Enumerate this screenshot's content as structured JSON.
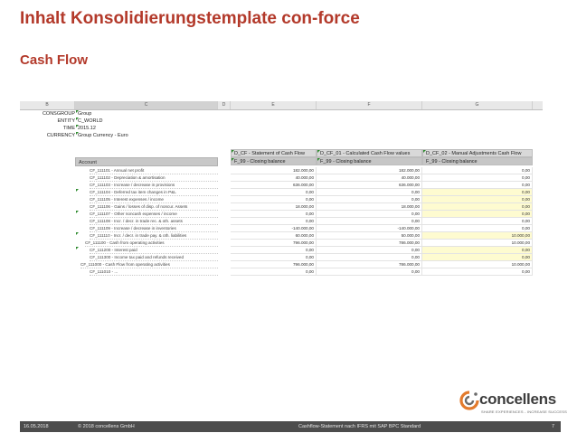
{
  "slide": {
    "title": "Inhalt Konsolidierungstemplate con-force",
    "subtitle": "Cash Flow"
  },
  "sheet": {
    "columns": [
      "B",
      "C",
      "D",
      "E",
      "F",
      "G"
    ],
    "meta": [
      {
        "key": "CONSGROUP",
        "value": "Group"
      },
      {
        "key": "ENTITY",
        "value": "C_WORLD"
      },
      {
        "key": "TIME",
        "value": "2015.12"
      },
      {
        "key": "CURRENCY",
        "value": "Group Currency - Euro"
      }
    ],
    "account_header": "Account",
    "col_headers": [
      {
        "top": "D_CF - Statement of Cash Flow",
        "bottom": "F_99 - Closing balance"
      },
      {
        "top": "D_CF_01 - Calculated Cash Flow values",
        "bottom": "F_99 - Closing balance"
      },
      {
        "top": "D_CF_02 - Manual Adjustments Cash Flow",
        "bottom": "F_99 - Closing balance"
      }
    ],
    "rows": [
      {
        "account": "CF_111101 - Annual net profit",
        "indent": 2,
        "values": [
          "182.000,00",
          "182.000,00",
          "0,00"
        ],
        "yellow": false,
        "mark": false
      },
      {
        "account": "CF_111102 - Depreciation & amortisation",
        "indent": 2,
        "values": [
          "40.000,00",
          "40.000,00",
          "0,00"
        ],
        "yellow": false,
        "mark": false
      },
      {
        "account": "CF_111103 - Increase / decrease in provisions",
        "indent": 2,
        "values": [
          "636.000,00",
          "636.000,00",
          "0,00"
        ],
        "yellow": false,
        "mark": false
      },
      {
        "account": "CF_111104 - Deferred tax item changes in P&L",
        "indent": 2,
        "values": [
          "0,00",
          "0,00",
          "0,00"
        ],
        "yellow": true,
        "mark": true
      },
      {
        "account": "CF_111105 - Interest expenses / income",
        "indent": 2,
        "values": [
          "0,00",
          "0,00",
          "0,00"
        ],
        "yellow": true,
        "mark": false
      },
      {
        "account": "CF_111106 - Gains / losses of disp. of noncur. Assets",
        "indent": 2,
        "values": [
          "18.000,00",
          "18.000,00",
          "0,00"
        ],
        "yellow": true,
        "mark": false
      },
      {
        "account": "CF_111107 - Other noncash expenses / income",
        "indent": 2,
        "values": [
          "0,00",
          "0,00",
          "0,00"
        ],
        "yellow": true,
        "mark": true
      },
      {
        "account": "CF_111108 - Incr. / decr. in trade rec. & oth. assets",
        "indent": 2,
        "values": [
          "0,00",
          "0,00",
          "0,00"
        ],
        "yellow": false,
        "mark": false
      },
      {
        "account": "CF_111109 - Increase / decrease in inventories",
        "indent": 2,
        "values": [
          "-140.000,00",
          "-140.000,00",
          "0,00"
        ],
        "yellow": false,
        "mark": false
      },
      {
        "account": "CF_111110 - Incr. / decr. in trade pay. & oth. liabilities",
        "indent": 2,
        "values": [
          "60.000,00",
          "50.000,00",
          "10.000,00"
        ],
        "yellow": true,
        "mark": true
      },
      {
        "account": "CF_111100 - Cash from operating activities",
        "indent": 1,
        "values": [
          "796.000,00",
          "786.000,00",
          "10.000,00"
        ],
        "yellow": false,
        "mark": false
      },
      {
        "account": "CF_111200 - Interest paid",
        "indent": 2,
        "values": [
          "0,00",
          "0,00",
          "0,00"
        ],
        "yellow": true,
        "mark": true
      },
      {
        "account": "CF_111300 - Income tax paid and refunds received",
        "indent": 2,
        "values": [
          "0,00",
          "0,00",
          "0,00"
        ],
        "yellow": true,
        "mark": false
      },
      {
        "account": "CF_111000 - Cash Flow from operating activities",
        "indent": 0,
        "values": [
          "796.000,00",
          "786.000,00",
          "10.000,00"
        ],
        "yellow": false,
        "mark": false
      },
      {
        "account": "CF_111010 - ...",
        "indent": 2,
        "values": [
          "0,00",
          "0,00",
          "0,00"
        ],
        "yellow": false,
        "mark": false
      }
    ]
  },
  "logo": {
    "name": "concellens",
    "tagline": "SHARE EXPERIENCES - INCREASE SUCCESS"
  },
  "footer": {
    "date": "16.05.2018",
    "copyright": "© 2018 concellens GmbH",
    "topic": "Cashflow-Statement nach IFRS mit SAP BPC Standard",
    "page": "7"
  },
  "colors": {
    "title": "#b3392a",
    "logo_orange": "#e37b2d",
    "footer_bg": "#4d4d4d",
    "input_yellow": "#fefbd0"
  }
}
